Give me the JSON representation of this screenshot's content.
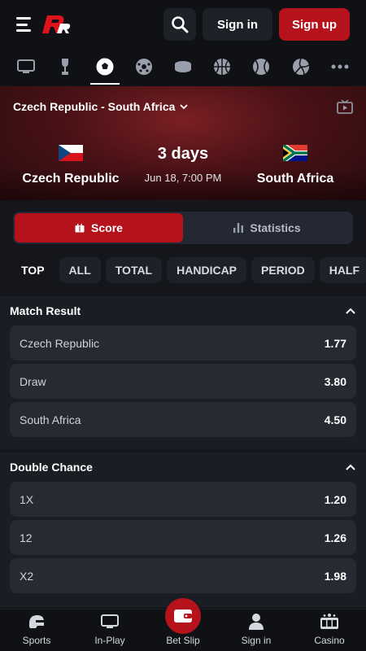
{
  "header": {
    "sign_in": "Sign in",
    "sign_up": "Sign up",
    "icons": [
      "menu-icon",
      "logo",
      "search-icon"
    ]
  },
  "sport_tabs": [
    {
      "icon": "live-tv-icon",
      "active": false
    },
    {
      "icon": "trophy-icon",
      "active": false
    },
    {
      "icon": "soccer-ball-icon",
      "active": true
    },
    {
      "icon": "futsal-icon",
      "active": false
    },
    {
      "icon": "hockey-puck-icon",
      "active": false
    },
    {
      "icon": "basketball-icon",
      "active": false
    },
    {
      "icon": "tennis-ball-icon",
      "active": false
    },
    {
      "icon": "volleyball-icon",
      "active": false
    },
    {
      "icon": "more-icon",
      "active": false
    }
  ],
  "match": {
    "title": "Czech Republic - South Africa",
    "home": "Czech Republic",
    "away": "South Africa",
    "countdown": "3 days",
    "kickoff": "Jun 18, 7:00 PM"
  },
  "toggle": {
    "score": "Score",
    "statistics": "Statistics"
  },
  "filters": [
    "TOP",
    "ALL",
    "TOTAL",
    "HANDICAP",
    "PERIOD",
    "HALF"
  ],
  "markets": [
    {
      "title": "Match Result",
      "outcomes": [
        {
          "name": "Czech Republic",
          "odds": "1.77"
        },
        {
          "name": "Draw",
          "odds": "3.80"
        },
        {
          "name": "South Africa",
          "odds": "4.50"
        }
      ]
    },
    {
      "title": "Double Chance",
      "outcomes": [
        {
          "name": "1X",
          "odds": "1.20"
        },
        {
          "name": "12",
          "odds": "1.26"
        },
        {
          "name": "X2",
          "odds": "1.98"
        }
      ]
    }
  ],
  "bottom_nav": {
    "sports": "Sports",
    "in_play": "In-Play",
    "bet_slip": "Bet Slip",
    "sign_in": "Sign in",
    "casino": "Casino"
  },
  "colors": {
    "accent": "#b5121b",
    "background": "#14161c",
    "card": "#262a33"
  }
}
